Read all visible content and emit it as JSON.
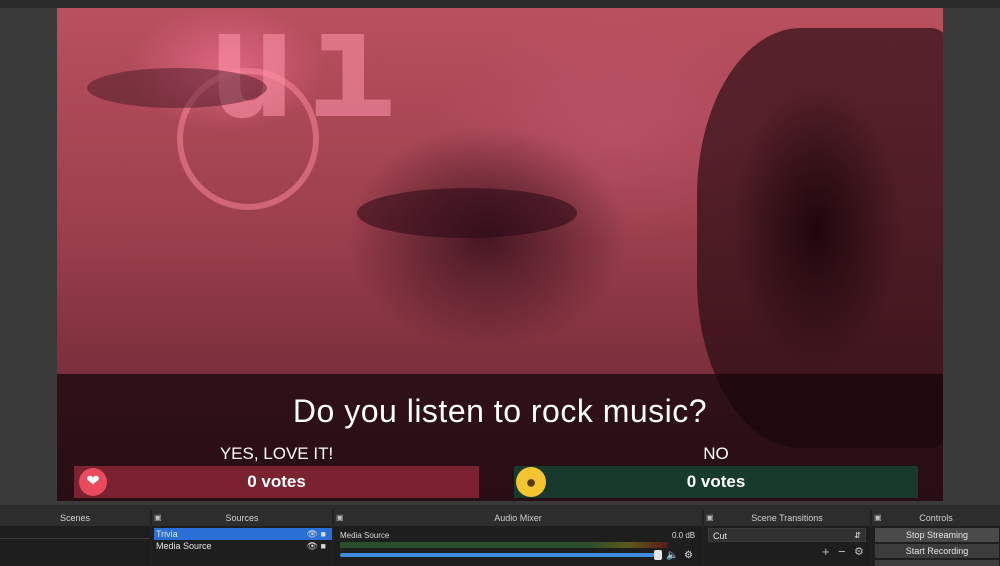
{
  "preview": {
    "question": "Do you listen to rock music?",
    "option_yes": {
      "label": "YES, LOVE IT!",
      "votes": "0 votes",
      "icon": "heart-icon",
      "color": "#7a2230"
    },
    "option_no": {
      "label": "NO",
      "votes": "0 votes",
      "icon": "wow-emoji-icon",
      "color": "#173a2c"
    }
  },
  "docks": {
    "scenes": {
      "title": "Scenes"
    },
    "sources": {
      "title": "Sources",
      "items": [
        {
          "label": "Trivia",
          "selected": true
        },
        {
          "label": "Media Source",
          "selected": false
        }
      ]
    },
    "audio_mixer": {
      "title": "Audio Mixer",
      "channel": "Media Source",
      "level": "0.0 dB",
      "volume_fraction": 0.98
    },
    "scene_transitions": {
      "title": "Scene Transitions",
      "selected": "Cut"
    },
    "controls": {
      "title": "Controls",
      "stop_streaming": "Stop Streaming",
      "start_recording": "Start Recording"
    }
  },
  "colors": {
    "accent": "#2a6fd6",
    "dock_bg": "#202020"
  }
}
